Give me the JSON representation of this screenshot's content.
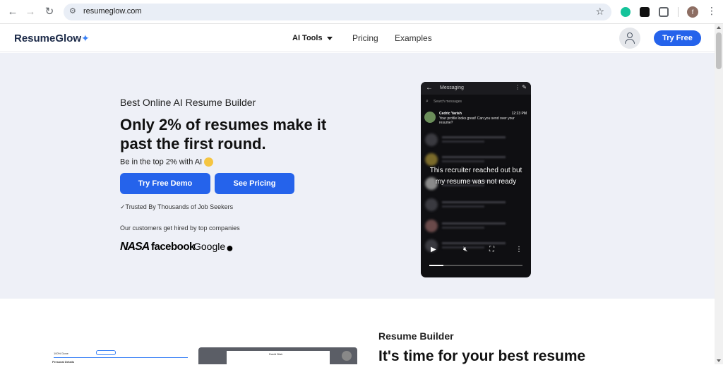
{
  "browser": {
    "url": "resumeglow.com",
    "profile_initial": "f"
  },
  "header": {
    "logo_text": "ResumeGlow",
    "nav": {
      "ai_tools": "AI Tools",
      "pricing": "Pricing",
      "examples": "Examples"
    },
    "try_free": "Try Free"
  },
  "hero": {
    "subtitle": "Best Online AI Resume Builder",
    "title": "Only 2% of resumes make it past the first round.",
    "tagline": "Be in the top 2% with AI",
    "demo_button": "Try Free Demo",
    "pricing_button": "See Pricing",
    "trusted": "✓Trusted By Thousands of Job Seekers",
    "customers": "Our customers get hired by top companies",
    "company_logos": [
      "NASA",
      "facebook",
      "Google",
      "Apple"
    ]
  },
  "video": {
    "app_title": "Messaging",
    "search_placeholder": "Search messages",
    "message": {
      "name": "Cedric Yarish",
      "time": "12:23 PM",
      "text": "Your profile looks great! Can you send over your resume?"
    },
    "caption": "This recruiter reached out but my resume was not ready",
    "progress": 0.15
  },
  "section2": {
    "label": "Resume Builder",
    "title": "It's time for your best resume",
    "preview_left_title": "100% Done",
    "preview_left_section": "Personal Details",
    "preview_right_name": "David Blair"
  },
  "colors": {
    "accent": "#2563eb",
    "hero_bg": "#eef0f7"
  }
}
